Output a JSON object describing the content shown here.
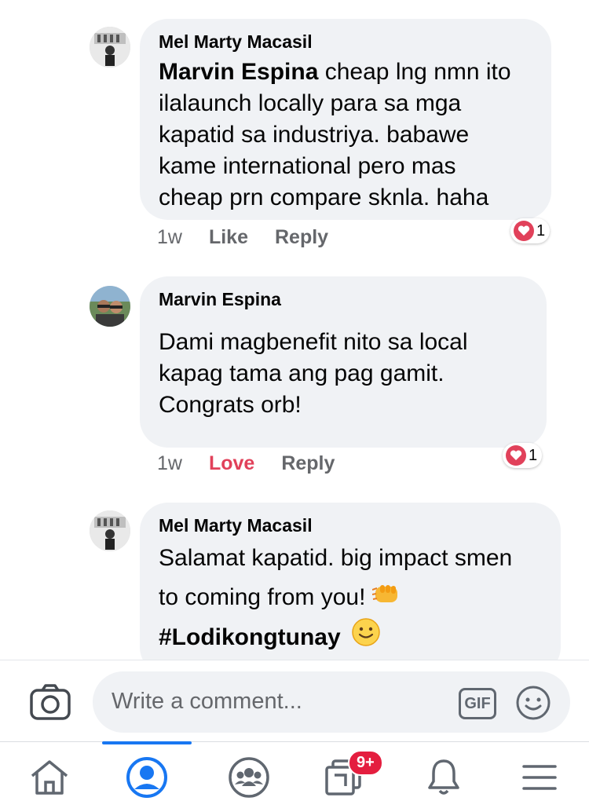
{
  "comments": [
    {
      "author": "Mel Marty Macasil",
      "mention": "Marvin Espina",
      "body_lines": [
        "cheap lng nmn ito",
        "ilalaunch locally para sa mga",
        "kapatid sa industriya. babawe",
        "kame international pero mas",
        "cheap prn compare sknla. haha"
      ],
      "time": "1w",
      "action1": "Like",
      "reply": "Reply",
      "reaction_count": "1"
    },
    {
      "author": "Marvin Espina",
      "body_lines": [
        "Dami magbenefit nito sa local",
        "kapag tama ang pag gamit.",
        "Congrats orb!"
      ],
      "time": "1w",
      "action1": "Love",
      "reply": "Reply",
      "reaction_count": "1"
    },
    {
      "author": "Mel Marty Macasil",
      "body_lines": [
        "Salamat kapatid. big impact smen",
        "to coming from you!",
        "#Lodikongtunay"
      ]
    }
  ],
  "composer": {
    "placeholder": "Write a comment...",
    "gif_label": "GIF"
  },
  "nav": {
    "notification_badge": "9+"
  },
  "colors": {
    "accent": "#1877f2",
    "love": "#e1415a",
    "badge": "#e41e3f",
    "bubble": "#f0f2f5"
  }
}
